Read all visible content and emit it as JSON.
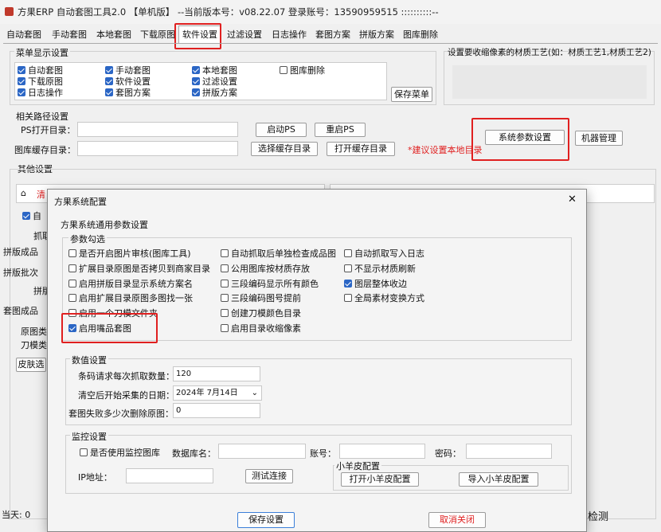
{
  "window": {
    "title": "方果ERP 自动套图工具2.0 【单机版】 --当前版本号：v08.22.07 登录账号：13590959515 ::::::::::--"
  },
  "tabs": [
    "自动套图",
    "手动套图",
    "本地套图",
    "下载原图",
    "软件设置",
    "过滤设置",
    "日志操作",
    "套图方案",
    "拼版方案",
    "图库删除"
  ],
  "active_tab": "软件设置",
  "menu_display": {
    "label": "菜单显示设置",
    "items": [
      {
        "label": "自动套图",
        "checked": true
      },
      {
        "label": "手动套图",
        "checked": true
      },
      {
        "label": "本地套图",
        "checked": true
      },
      {
        "label": "图库删除",
        "checked": false
      },
      {
        "label": "下载原图",
        "checked": true
      },
      {
        "label": "软件设置",
        "checked": true
      },
      {
        "label": "过滤设置",
        "checked": true
      },
      {
        "label": "日志操作",
        "checked": true
      },
      {
        "label": "套图方案",
        "checked": true
      },
      {
        "label": "拼版方案",
        "checked": true
      }
    ],
    "save_menu": "保存菜单"
  },
  "shrink_note": "设置要收缩像素的材质工艺(如：材质工艺1,材质工艺2)",
  "paths": {
    "label": "相关路径设置",
    "ps_open_label": "PS打开目录：",
    "cache_label": "图库缓存目录：",
    "start_ps": "启动PS",
    "restart_ps": "重启PS",
    "choose_cache": "选择缓存目录",
    "open_cache": "打开缓存目录",
    "tip": "*建议设置本地目录",
    "sys_params": "系统参数设置",
    "machine_mgmt": "机器管理"
  },
  "other": {
    "label": "其他设置",
    "partial_clear": "清",
    "partial_auto": "自",
    "partial_grab": "抓取",
    "partial_pinban": "拼版成品",
    "partial_pinbanpi": "拼版批次",
    "partial_pin": "拼版",
    "partial_taotu": "套图成品",
    "partial_yuantu": "原图类",
    "partial_daomo": "刀模类",
    "partial_skin": "皮肤选",
    "today": "当天: 0",
    "detect": "检测"
  },
  "dialog": {
    "title": "方果系统配置",
    "close": "✕",
    "general_label": "方果系统通用参数设置",
    "params_label": "参数勾选",
    "checkboxes": [
      {
        "label": "是否开启图片审核(图库工具)",
        "checked": false
      },
      {
        "label": "自动抓取后单独检查成品图",
        "checked": false
      },
      {
        "label": "自动抓取写入日志",
        "checked": false
      },
      {
        "label": "扩展目录原图是否拷贝到商家目录",
        "checked": false
      },
      {
        "label": "公用图库按材质存放",
        "checked": false
      },
      {
        "label": "不显示材质刷新",
        "checked": false
      },
      {
        "label": "启用拼版目录显示系统方案名",
        "checked": false
      },
      {
        "label": "三段编码显示所有颜色",
        "checked": false
      },
      {
        "label": "图层整体收边",
        "checked": true
      },
      {
        "label": "启用扩展目录原图多图找一张",
        "checked": false
      },
      {
        "label": "三段编码图号提前",
        "checked": false
      },
      {
        "label": "全局素材变换方式",
        "checked": false
      },
      {
        "label": "启用一个刀模文件夹",
        "checked": false
      },
      {
        "label": "创建刀模颜色目录",
        "checked": false
      },
      {
        "label": "启用嘴品套图",
        "checked": true
      },
      {
        "label": "启用目录收缩像素",
        "checked": false
      }
    ],
    "numeric": {
      "label": "数值设置",
      "barcode_label": "条码请求每次抓取数量：",
      "barcode_value": "120",
      "date_label": "清空后开始采集的日期：",
      "date_value": "2024年  7月14日",
      "fail_label": "套图失败多少次删除原图：",
      "fail_value": "0"
    },
    "monitor": {
      "label": "监控设置",
      "use_monitor": "是否使用监控图库",
      "use_monitor_checked": false,
      "db_label": "数据库名：",
      "account_label": "账号：",
      "password_label": "密码：",
      "ip_label": "IP地址：",
      "test_btn": "测试连接",
      "sheep_label": "小羊皮配置",
      "open_sheep": "打开小羊皮配置",
      "import_sheep": "导入小羊皮配置"
    },
    "save": "保存设置",
    "cancel": "取消关闭"
  }
}
